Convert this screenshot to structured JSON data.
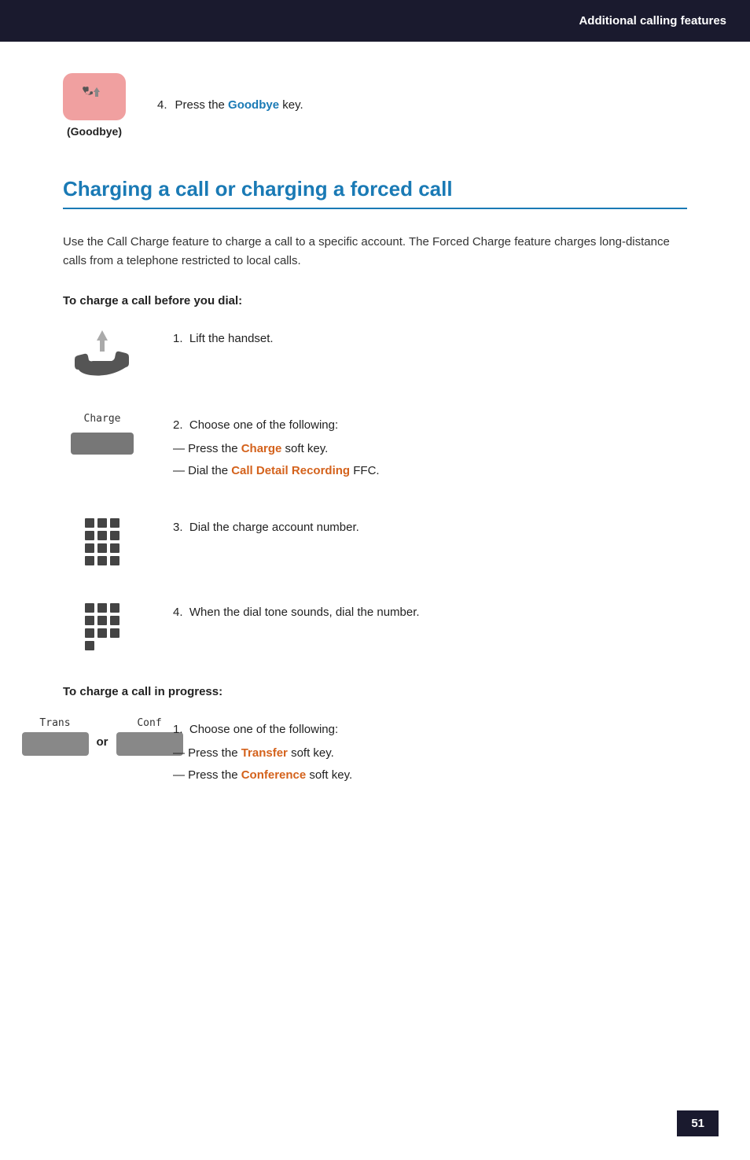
{
  "header": {
    "title": "Additional calling features"
  },
  "goodbye_section": {
    "step_num": "4.",
    "step_text_pre": "Press the ",
    "step_key": "Goodbye",
    "step_text_post": " key.",
    "label": "(Goodbye)"
  },
  "section": {
    "title": "Charging a call or charging a forced call",
    "description": "Use the Call Charge feature to charge a call to a specific account. The Forced Charge feature charges long-distance calls from a telephone restricted to local calls.",
    "before_dial_heading": "To charge a call before you dial:",
    "before_dial_steps": [
      {
        "num": "1.",
        "text": "Lift the handset."
      },
      {
        "num": "2.",
        "text_pre": "Choose one of the following:",
        "bullets": [
          {
            "pre": "Press the ",
            "key": "Charge",
            "post": " soft key."
          },
          {
            "pre": "Dial the ",
            "key": "Call Detail Recording",
            "post": " FFC."
          }
        ],
        "softkey_label": "Charge"
      },
      {
        "num": "3.",
        "text": "Dial the charge account number."
      },
      {
        "num": "4.",
        "text": "When the dial tone sounds, dial the number."
      }
    ],
    "in_progress_heading": "To charge a call in progress:",
    "in_progress_steps": [
      {
        "num": "1.",
        "text_pre": "Choose one of the following:",
        "bullets": [
          {
            "pre": "Press the ",
            "key": "Transfer",
            "post": " soft key."
          },
          {
            "pre": "Press the ",
            "key": "Conference",
            "post": " soft key."
          }
        ],
        "trans_label": "Trans",
        "or_label": "or",
        "conf_label": "Conf"
      }
    ]
  },
  "page_num": "51"
}
